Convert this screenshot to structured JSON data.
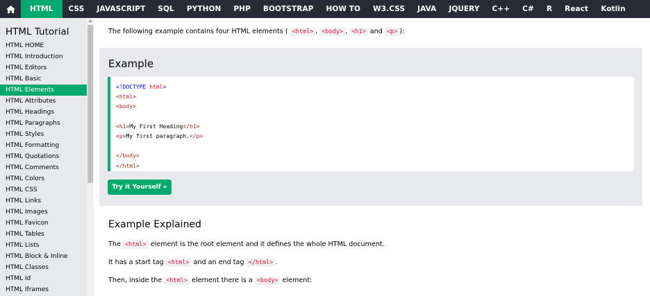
{
  "topnav": {
    "home_icon": "home-icon",
    "items": [
      "HTML",
      "CSS",
      "JAVASCRIPT",
      "SQL",
      "PYTHON",
      "PHP",
      "BOOTSTRAP",
      "HOW TO",
      "W3.CSS",
      "JAVA",
      "JQUERY",
      "C++",
      "C#",
      "R",
      "React",
      "Kotlin"
    ],
    "active_index": 0
  },
  "sidebar": {
    "title": "HTML Tutorial",
    "items": [
      "HTML HOME",
      "HTML Introduction",
      "HTML Editors",
      "HTML Basic",
      "HTML Elements",
      "HTML Attributes",
      "HTML Headings",
      "HTML Paragraphs",
      "HTML Styles",
      "HTML Formatting",
      "HTML Quotations",
      "HTML Comments",
      "HTML Colors",
      "HTML CSS",
      "HTML Links",
      "HTML Images",
      "HTML Favicon",
      "HTML Tables",
      "HTML Lists",
      "HTML Block & Inline",
      "HTML Classes",
      "HTML Id",
      "HTML Iframes"
    ],
    "active_index": 4
  },
  "intro": {
    "before": "The following example contains four HTML elements (",
    "tag1": "<html>",
    "sep1": ",",
    "tag2": "<body>",
    "sep2": ",",
    "tag3": "<h1>",
    "and": "and",
    "tag4": "<p>",
    "after": "):"
  },
  "example": {
    "title": "Example",
    "code": {
      "doctype_open": "<!DOCTYPE",
      "doctype_attr": " html",
      "doctype_close": ">",
      "html_open": "<html>",
      "body_open": "<body>",
      "h1_open": "<h1>",
      "h1_text": "My First Heading",
      "h1_close": "</h1>",
      "p_open": "<p>",
      "p_text": "My first paragraph.",
      "p_close": "</p>",
      "body_close": "</body>",
      "html_close": "</html>"
    },
    "try_button": "Try it Yourself »"
  },
  "explained": {
    "title": "Example Explained",
    "line1": {
      "before": "The",
      "tag": "<html>",
      "after": "element is the root element and it defines the whole HTML document."
    },
    "line2": {
      "before": "It has a start tag",
      "tag1": "<html>",
      "mid": "and an end tag",
      "tag2": "</html>",
      "after": "."
    },
    "line3": {
      "before": "Then, inside the",
      "tag1": "<html>",
      "mid": "element there is a",
      "tag2": "<body>",
      "after": "element:"
    }
  },
  "colors": {
    "nav_bg": "#282a35",
    "accent": "#04aa6d",
    "sidebar_bg": "#e7e9eb",
    "code_tag": "#dc143c"
  }
}
